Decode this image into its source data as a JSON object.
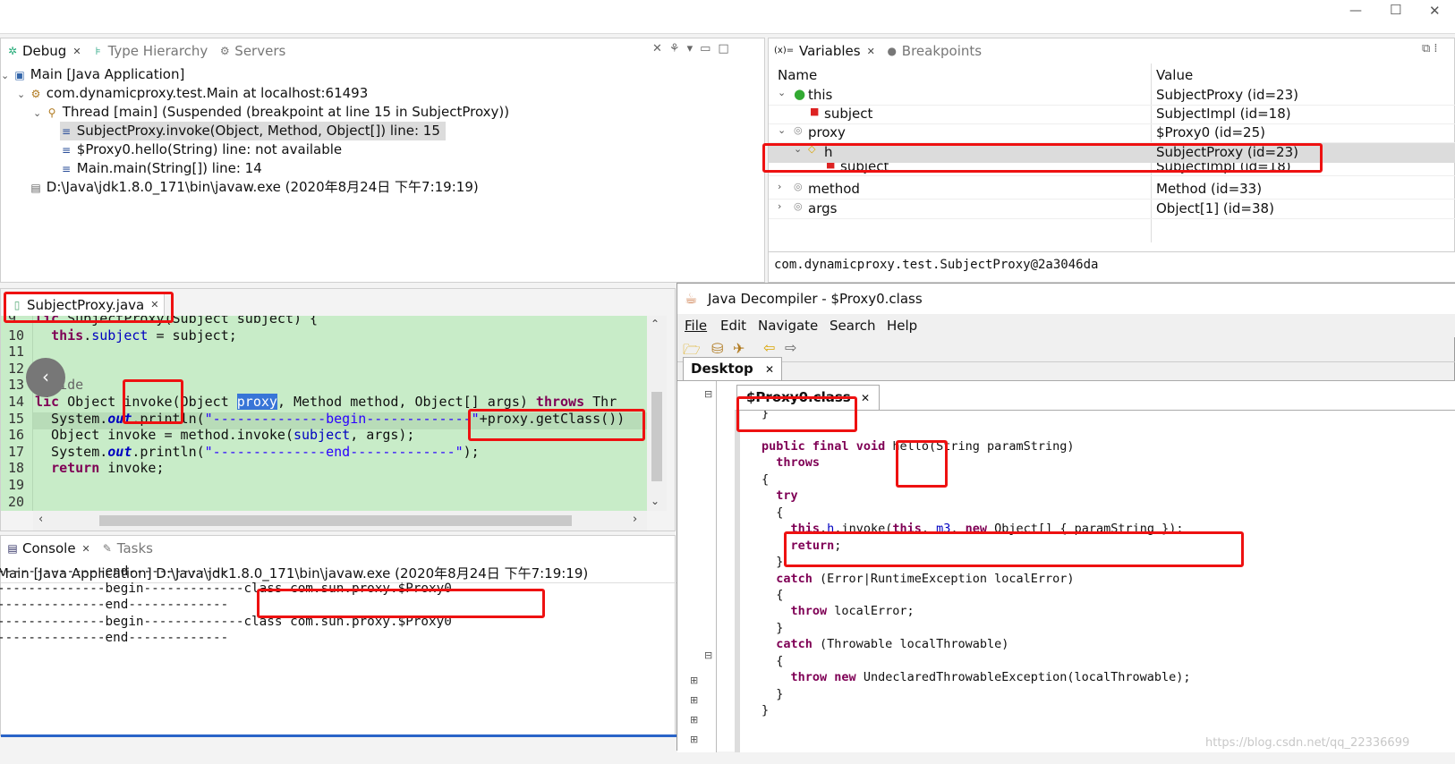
{
  "window_controls": {
    "minimize": "—",
    "maximize": "☐",
    "close": "✕"
  },
  "debug_view": {
    "tabs": [
      {
        "label": "Debug"
      },
      {
        "label": "Type Hierarchy"
      },
      {
        "label": "Servers"
      }
    ],
    "tree": [
      "Main [Java Application]",
      "com.dynamicproxy.test.Main at localhost:61493",
      "Thread [main] (Suspended (breakpoint at line 15 in SubjectProxy))",
      "SubjectProxy.invoke(Object, Method, Object[]) line: 15",
      "$Proxy0.hello(String) line: not available",
      "Main.main(String[]) line: 14",
      "D:\\Java\\jdk1.8.0_171\\bin\\javaw.exe (2020年8月24日 下午7:19:19)"
    ]
  },
  "variables_view": {
    "tabs": [
      {
        "label": "Variables"
      },
      {
        "label": "Breakpoints"
      }
    ],
    "columns": {
      "name": "Name",
      "value": "Value"
    },
    "rows": [
      {
        "name": "this",
        "value": "SubjectProxy  (id=23)"
      },
      {
        "name": "subject",
        "value": "SubjectImpl  (id=18)"
      },
      {
        "name": "proxy",
        "value": "$Proxy0  (id=25)"
      },
      {
        "name": "h",
        "value": "SubjectProxy  (id=23)"
      },
      {
        "name": "subject",
        "value": "SubjectImpl  (id=18)"
      },
      {
        "name": "method",
        "value": "Method  (id=33)"
      },
      {
        "name": "args",
        "value": "Object[1]  (id=38)"
      }
    ],
    "detail": "com.dynamicproxy.test.SubjectProxy@2a3046da"
  },
  "editor": {
    "tab_label": "SubjectProxy.java",
    "lines": [
      {
        "num": "9",
        "text": "lic SubjectProxy(Subject subject) {"
      },
      {
        "num": "10",
        "text": "this.subject = subject;"
      },
      {
        "num": "11",
        "text": ""
      },
      {
        "num": "12",
        "text": ""
      },
      {
        "num": "13",
        "text": "erride"
      },
      {
        "num": "14",
        "text": "lic Object invoke(Object proxy, Method method, Object[] args) throws Thr"
      },
      {
        "num": "15",
        "text": "System.out.println(\"--------------begin-------------\"+proxy.getClass())"
      },
      {
        "num": "16",
        "text": "Object invoke = method.invoke(subject, args);"
      },
      {
        "num": "17",
        "text": "System.out.println(\"--------------end-------------\");"
      },
      {
        "num": "18",
        "text": "return invoke;"
      },
      {
        "num": "19",
        "text": ""
      },
      {
        "num": "20",
        "text": ""
      }
    ]
  },
  "console": {
    "tabs": [
      {
        "label": "Console"
      },
      {
        "label": "Tasks"
      }
    ],
    "header": "Main [Java Application] D:\\Java\\jdk1.8.0_171\\bin\\javaw.exe (2020年8月24日 下午7:19:19)",
    "lines": [
      "--------------end-------------",
      "--------------begin-------------class com.sun.proxy.$Proxy0",
      "--------------end-------------",
      "--------------begin-------------class com.sun.proxy.$Proxy0",
      "--------------end-------------"
    ]
  },
  "decompiler": {
    "title": "Java Decompiler - $Proxy0.class",
    "menu": [
      "File",
      "Edit",
      "Navigate",
      "Search",
      "Help"
    ],
    "desktop_tab": "Desktop",
    "file_tab": "$Proxy0.class",
    "code": [
      "}",
      "",
      "public final void hello(String paramString)",
      "  throws",
      "{",
      "  try",
      "  {",
      "    this.h.invoke(this, m3, new Object[] { paramString });",
      "    return;",
      "  }",
      "  catch (Error|RuntimeException localError)",
      "  {",
      "    throw localError;",
      "  }",
      "  catch (Throwable localThrowable)",
      "  {",
      "    throw new UndeclaredThrowableException(localThrowable);",
      "  }",
      "}"
    ],
    "watermark": "https://blog.csdn.net/qq_22336699"
  },
  "colors": {
    "highlight_red": "#e11111",
    "editor_bg": "#c8ecc8",
    "selection": "#dcdcdc"
  }
}
